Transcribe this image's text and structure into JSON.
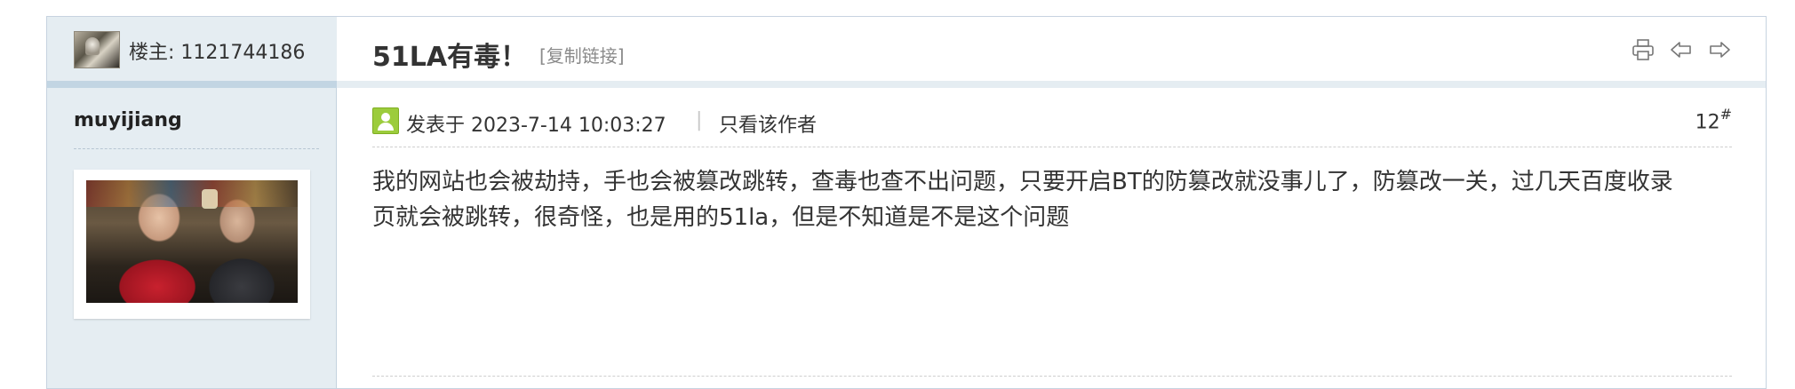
{
  "sidebar": {
    "op_label": "楼主: 1121744186",
    "author_name": "muyijiang"
  },
  "thread": {
    "title": "51LA有毒！",
    "copy_link": "[复制链接]"
  },
  "toolbar": {
    "icons": [
      "print-icon",
      "prev-thread-icon",
      "next-thread-icon"
    ]
  },
  "post": {
    "posted_at": "发表于 2023-7-14 10:03:27",
    "separator": "|",
    "only_author": "只看该作者",
    "floor": "12",
    "floor_suffix": "#",
    "body": "我的网站也会被劫持，手也会被篡改跳转，查毒也查不出问题，只要开启BT的防篡改就没事儿了，防篡改一关，过几天百度收录页就会被跳转，很奇怪，也是用的51la，但是不知道是不是这个问题"
  },
  "colors": {
    "sidebar_bg": "#e5edf2",
    "separator_band": "#c2d5e3",
    "online_badge": "#9ccc3c"
  }
}
